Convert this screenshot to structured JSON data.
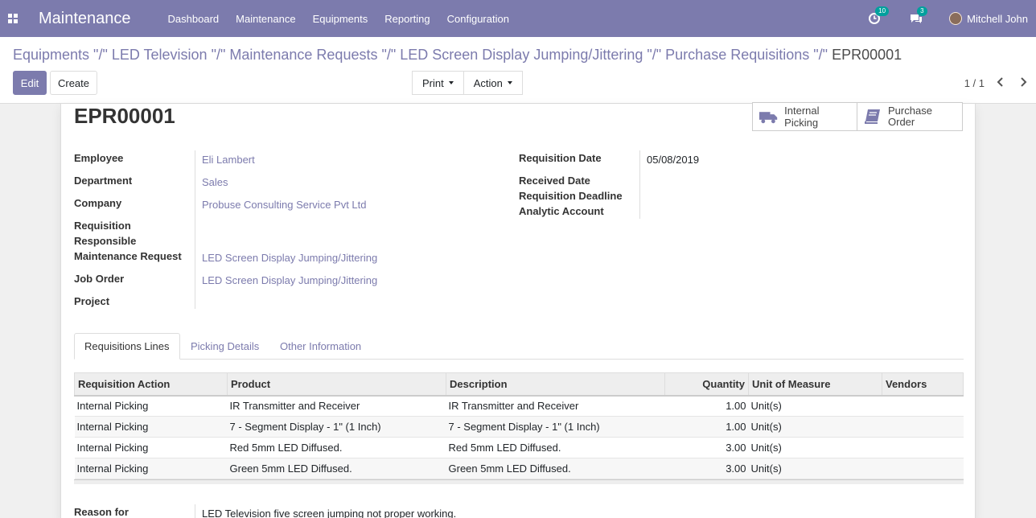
{
  "navbar": {
    "app_title": "Maintenance",
    "menu": [
      "Dashboard",
      "Maintenance",
      "Equipments",
      "Reporting",
      "Configuration"
    ],
    "activity_count": "10",
    "message_count": "3",
    "user_name": "Mitchell John"
  },
  "breadcrumb": {
    "path": "Equipments \"/\" LED Television \"/\" Maintenance Requests \"/\" LED Screen Display Jumping/Jittering \"/\" Purchase Requisitions \"/\"",
    "current": "EPR00001"
  },
  "toolbar": {
    "edit_label": "Edit",
    "create_label": "Create",
    "print_label": "Print",
    "action_label": "Action",
    "pager": "1 / 1"
  },
  "record": {
    "title": "EPR00001",
    "smart_buttons": {
      "internal_picking": "Internal Picking",
      "purchase_order": "Purchase Order"
    },
    "fields_left": {
      "employee_label": "Employee",
      "employee_value": "Eli Lambert",
      "department_label": "Department",
      "department_value": "Sales",
      "company_label": "Company",
      "company_value": "Probuse Consulting Service Pvt Ltd",
      "requisition_responsible_label": "Requisition Responsible",
      "maintenance_request_label": "Maintenance Request",
      "maintenance_request_value": "LED Screen Display Jumping/Jittering",
      "job_order_label": "Job Order",
      "job_order_value": "LED Screen Display Jumping/Jittering",
      "project_label": "Project"
    },
    "fields_right": {
      "requisition_date_label": "Requisition Date",
      "requisition_date_value": "05/08/2019",
      "received_date_label": "Received Date",
      "requisition_deadline_label": "Requisition Deadline",
      "analytic_account_label": "Analytic Account"
    },
    "reason_label": "Reason for",
    "reason_value": "LED Television five screen jumping not proper working."
  },
  "tabs": [
    "Requisitions Lines",
    "Picking Details",
    "Other Information"
  ],
  "lines": {
    "headers": [
      "Requisition Action",
      "Product",
      "Description",
      "Quantity",
      "Unit of Measure",
      "Vendors"
    ],
    "rows": [
      [
        "Internal Picking",
        "IR Transmitter and Receiver",
        "IR Transmitter and Receiver",
        "1.00",
        "Unit(s)",
        ""
      ],
      [
        "Internal Picking",
        "7 - Segment Display - 1\" (1 Inch)",
        "7 - Segment Display - 1\" (1 Inch)",
        "1.00",
        "Unit(s)",
        ""
      ],
      [
        "Internal Picking",
        "Red 5mm LED Diffused.",
        "Red 5mm LED Diffused.",
        "3.00",
        "Unit(s)",
        ""
      ],
      [
        "Internal Picking",
        "Green 5mm LED Diffused.",
        "Green 5mm LED Diffused.",
        "3.00",
        "Unit(s)",
        ""
      ]
    ]
  },
  "colors": {
    "primary": "#7c7bad",
    "badge": "#00a09d"
  }
}
